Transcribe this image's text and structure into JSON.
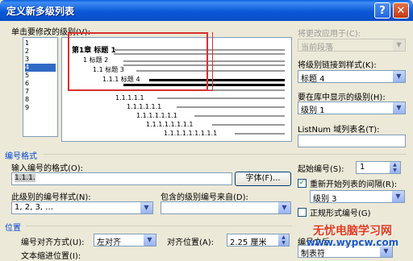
{
  "window": {
    "title": "定义新多级列表",
    "help_glyph": "?",
    "close_glyph": "✕"
  },
  "level_picker": {
    "label": "单击要修改的级别(V):",
    "levels": [
      "1",
      "2",
      "3",
      "4",
      "5",
      "6",
      "7",
      "8",
      "9"
    ],
    "selected": "4"
  },
  "preview": {
    "rows": [
      "第1章 标题 1",
      "1 标题 2",
      "1.1 标题 3",
      "1.1.1 标题 4"
    ],
    "dots": [
      "1.1.1.1.1",
      "1.1.1.1.1.1",
      "1.1.1.1.1.1.1",
      "1.1.1.1.1.1.1.1",
      "1.1.1.1.1.1.1.1.1"
    ]
  },
  "right_panel": {
    "apply_to_label": "将更改应用于(C):",
    "apply_to_value": "当前段落",
    "link_style_label": "将级别链接到样式(K):",
    "link_style_value": "标题 4",
    "gallery_level_label": "要在库中显示的级别(H):",
    "gallery_level_value": "级别 1",
    "listnum_label": "ListNum 域列表名(T):",
    "listnum_value": ""
  },
  "number_format": {
    "section_label": "编号格式",
    "format_label": "输入编号的格式(O):",
    "format_value": "1.1.1.",
    "font_button": "字体(F)...",
    "style_label": "此级别的编号样式(N):",
    "style_value": "1, 2, 3, …",
    "include_label": "包含的级别编号来自(D):",
    "include_value": "",
    "start_label": "起始编号(S):",
    "start_value": "1",
    "restart_label": "重新开始列表的间隔(R):",
    "restart_checked": true,
    "restart_value": "级别 3",
    "legal_label": "正规形式编号(G)",
    "legal_checked": false
  },
  "position": {
    "section_label": "位置",
    "align_label": "编号对齐方式(U):",
    "align_value": "左对齐",
    "align_at_label": "对齐位置(A):",
    "align_at_value": "2.25 厘米",
    "follow_label": "编号之后",
    "follow_value": "制表符",
    "indent_label": "文本缩进位置(I):"
  },
  "watermark": {
    "line1": "无忧电脑学习网",
    "line2": "www.wypcw.com"
  },
  "colors": {
    "title_bar": "#0a5ddc",
    "dialog_bg": "#ece9d8",
    "highlight": "#316ac5",
    "annotation": "#d9302c",
    "section_text": "#0046d5"
  }
}
